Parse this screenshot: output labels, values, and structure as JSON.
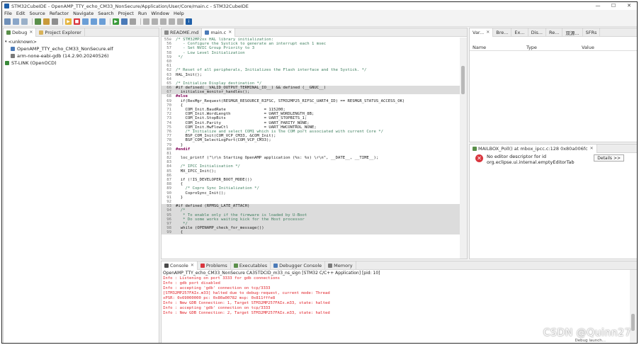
{
  "window": {
    "title": "STM32CubeIDE - OpenAMP_TTY_echo_CM33_NonSecure/Application/User/Core/main.c - STM32CubeIDE"
  },
  "menu": [
    "File",
    "Edit",
    "Source",
    "Refactor",
    "Navigate",
    "Search",
    "Project",
    "Run",
    "Window",
    "Help"
  ],
  "left": {
    "tabs": [
      "Debug",
      "Project Explorer"
    ],
    "tree": [
      "<unknown>",
      "OpenAMP_TTY_echo_CM33_NonSecure.elf",
      "arm-none-eabi-gdb (14.2.90.20240526)",
      "ST-LINK (OpenOCD)"
    ]
  },
  "editor": {
    "tabs": [
      "README.md",
      "main.c"
    ],
    "lines": [
      {
        "n": "55⊖",
        "t": "/* STM32MP2xx HAL library initialization:",
        "c": "cm"
      },
      {
        "n": "56",
        "t": "   - Configure the Systick to generate an interrupt each 1 msec",
        "c": "cm"
      },
      {
        "n": "57",
        "t": "   - Set NVIC Group Priority to 3",
        "c": "cm"
      },
      {
        "n": "58",
        "t": "   - Low Level Initialization",
        "c": "cm"
      },
      {
        "n": "59",
        "t": " */",
        "c": "cm"
      },
      {
        "n": "60",
        "t": "",
        "c": ""
      },
      {
        "n": "61",
        "t": "",
        "c": ""
      },
      {
        "n": "62",
        "t": "/* Reset of all peripherals, Initializes the Flash interface and the Systick. */",
        "c": "cm"
      },
      {
        "n": "63",
        "t": "HAL_Init();",
        "c": ""
      },
      {
        "n": "64",
        "t": "",
        "c": ""
      },
      {
        "n": "65",
        "t": "/* Initialize Display destination */",
        "c": "cm"
      },
      {
        "n": "66",
        "t": "#if defined(__VALID_OUTPUT_TERMINAL_IO__) && defined (__GNUC__)",
        "c": "hl"
      },
      {
        "n": "67",
        "t": "  initialise_monitor_handles();",
        "c": "hl"
      },
      {
        "n": "68",
        "t": "#else",
        "c": "kw"
      },
      {
        "n": "69",
        "t": "  if(ResMgr_Request(RESMGR_RESOURCE_RIFSC, STM32MP25_RIFSC_UART4_ID) == RESMGR_STATUS_ACCESS_OK)",
        "c": ""
      },
      {
        "n": "70",
        "t": "  {",
        "c": ""
      },
      {
        "n": "71",
        "t": "    COM_Init.BaudRate                = 115200;",
        "c": ""
      },
      {
        "n": "72",
        "t": "    COM_Init.WordLength              = UART_WORDLENGTH_8B;",
        "c": ""
      },
      {
        "n": "73",
        "t": "    COM_Init.StopBits                = UART_STOPBITS_1;",
        "c": ""
      },
      {
        "n": "74",
        "t": "    COM_Init.Parity                  = UART_PARITY_NONE;",
        "c": ""
      },
      {
        "n": "75",
        "t": "    COM_Init.HwFlowCtl               = UART_HWCONTROL_NONE;",
        "c": ""
      },
      {
        "n": "76",
        "t": "    /* Initialize and select COM1 which is the COM port associated with current Core */",
        "c": "cm"
      },
      {
        "n": "77",
        "t": "    BSP_COM_Init(COM_VCP_CM33, &COM_Init);",
        "c": ""
      },
      {
        "n": "78",
        "t": "    BSP_COM_SelectLogPort(COM_VCP_CM33);",
        "c": ""
      },
      {
        "n": "79",
        "t": "  }",
        "c": ""
      },
      {
        "n": "80",
        "t": "#endif",
        "c": "kw"
      },
      {
        "n": "81",
        "t": "",
        "c": ""
      },
      {
        "n": "82",
        "t": "  loc_printf (\"\\r\\n Starting OpenAMP application (%s: %s) \\r\\n\", __DATE__, __TIME__);",
        "c": ""
      },
      {
        "n": "83",
        "t": "",
        "c": ""
      },
      {
        "n": "84",
        "t": "  /* IPCC Initialisation */",
        "c": "cm"
      },
      {
        "n": "85",
        "t": "  MX_IPCC_Init();",
        "c": ""
      },
      {
        "n": "86",
        "t": "",
        "c": ""
      },
      {
        "n": "87",
        "t": "  if (!IS_DEVELOPER_BOOT_MODE())",
        "c": ""
      },
      {
        "n": "88",
        "t": "  {",
        "c": ""
      },
      {
        "n": "89",
        "t": "    /* Copro Sync Initialization */",
        "c": "cm"
      },
      {
        "n": "90",
        "t": "    CoproSync_Init();",
        "c": ""
      },
      {
        "n": "91",
        "t": "  }",
        "c": ""
      },
      {
        "n": "92",
        "t": "",
        "c": ""
      },
      {
        "n": "93",
        "t": "#if defined (RPMSG_LATE_ATTACH)",
        "c": "hl"
      },
      {
        "n": "94",
        "t": "  /*",
        "c": "hlcm"
      },
      {
        "n": "95",
        "t": "   * To enable only if the firmware is loaded by U-Boot",
        "c": "hlcm"
      },
      {
        "n": "96",
        "t": "   * Do some works waiting kick for the Host processor",
        "c": "hlcm"
      },
      {
        "n": "97",
        "t": "   */",
        "c": "hlcm"
      },
      {
        "n": "98",
        "t": "  while (OPENAMP_check_for_message())",
        "c": "hl"
      },
      {
        "n": "99",
        "t": "  {",
        "c": "hl"
      }
    ]
  },
  "right_top": {
    "tabs": [
      "Var...",
      "Bre...",
      "Ex...",
      "Dis...",
      "Re...",
      "双源...",
      "SFRs"
    ],
    "columns": [
      "Name",
      "Type",
      "Value"
    ]
  },
  "right_bottom": {
    "tab": "MAILBOX_Poll() at mbox_ipcc.c:128 0x80a006fc",
    "error_line1": "No editor descriptor for id",
    "error_line2": "org.eclipse.ui.internal.emptyEditorTab",
    "details_label": "Details >>"
  },
  "console": {
    "tabs": [
      "Console",
      "Problems",
      "Executables",
      "Debugger Console",
      "Memory"
    ],
    "header": "OpenAMP_TTY_echo_CM33_NonSecure CA35TDCID_m33_ns_sign [STM32 C/C++ Application]  [pid: 10]",
    "lines": [
      "Info : Listening on port 3333 for gdb connections",
      "Info : gdb port disabled",
      "Info : accepting 'gdb' connection on tcp/3333",
      "[STM32MP257FAIx.m33] halted due to debug-request, current mode: Thread",
      "xPSR: 0x69000000 pc: 0x80a00782 msp: 0x811fffe8",
      "Info : New GDB Connection: 1, Target STM32MP257FAIx.m33, state: halted",
      "Info : accepting 'gdb' connection on tcp/3333",
      "Info : New GDB Connection: 2, Target STM32MP257FAIx.m33, state: halted"
    ]
  },
  "status": {
    "text": "Debug launch..."
  },
  "watermark": "CSDN @Quinn27"
}
